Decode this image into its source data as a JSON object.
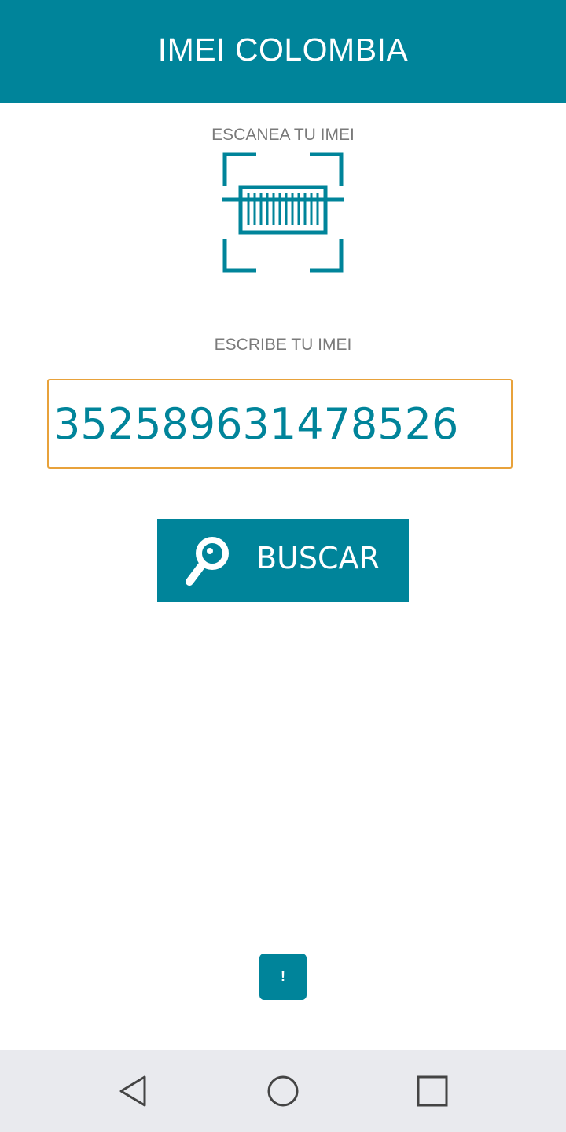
{
  "header": {
    "title": "IMEI COLOMBIA"
  },
  "scan": {
    "label": "ESCANEA TU IMEI",
    "icon": "barcode-scan-icon"
  },
  "type_section": {
    "label": "ESCRIBE TU IMEI"
  },
  "imei_input": {
    "value": "352589631478526"
  },
  "search_button": {
    "label": "BUSCAR",
    "icon": "search-icon"
  },
  "info_button": {
    "label": "!"
  },
  "nav": {
    "back_icon": "back-triangle-icon",
    "home_icon": "home-circle-icon",
    "recents_icon": "recents-square-icon"
  },
  "colors": {
    "primary": "#00849a",
    "input_border": "#e8a23b",
    "label_gray": "#7a7a7a",
    "nav_background": "#e9eaee"
  }
}
